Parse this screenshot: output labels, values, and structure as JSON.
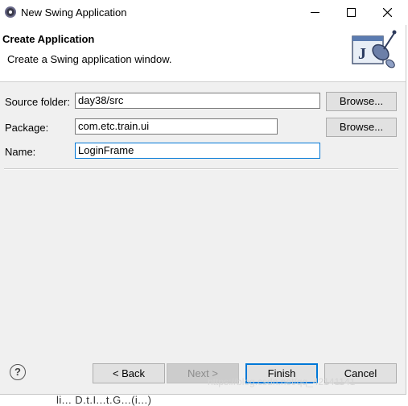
{
  "window": {
    "title": "New Swing Application",
    "controls": {
      "minimize": "minimize",
      "maximize": "maximize",
      "close": "close"
    }
  },
  "banner": {
    "title": "Create Application",
    "description": "Create a Swing application window."
  },
  "form": {
    "source_folder": {
      "label": "Source folder:",
      "value": "day38/src",
      "browse_label": "Browse..."
    },
    "package": {
      "label": "Package:",
      "value": "com.etc.train.ui",
      "browse_label": "Browse..."
    },
    "name": {
      "label": "Name:",
      "value": "LoginFrame"
    }
  },
  "buttons": {
    "help": "?",
    "back": "< Back",
    "next": "Next >",
    "finish": "Finish",
    "cancel": "Cancel"
  },
  "background_text": {
    "under_window": "li...       D.t.I...t.G...(i...)",
    "watermark": "https://blog.csdn.net/qq_42141141"
  },
  "colors": {
    "accent": "#0078d7",
    "window_bg": "#f0f0f0",
    "banner_bg": "#ffffff"
  },
  "icons": {
    "app": "eclipse-icon",
    "banner": "java-swing-wizard-icon",
    "help": "help-icon"
  }
}
